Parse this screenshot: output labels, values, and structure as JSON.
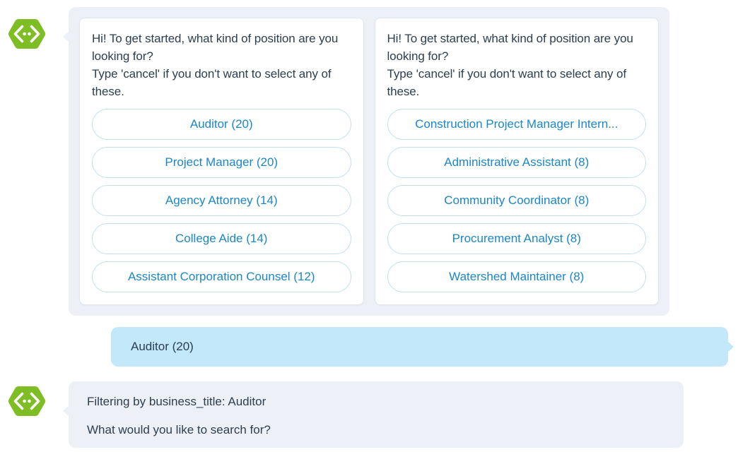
{
  "theme": {
    "avatar_green": "#7fbd25",
    "bot_bubble_bg": "#edf1f7",
    "user_bubble_bg": "#c3e8fa",
    "link_blue": "#1b87c9",
    "text_dark": "#2c3e50",
    "option_border": "#c4dfeb",
    "card_bg": "#ffffff",
    "card_border": "#e3e7ec",
    "page_bg": "#ffffff"
  },
  "messages": [
    {
      "sender": "bot",
      "avatar_icon": "code-brackets-hexagon-icon",
      "type": "option-cards",
      "cards": [
        {
          "prompt_line_1": "Hi! To get started, what kind of position are you looking for?",
          "prompt_line_2": "Type 'cancel' if you don't want to select any of these.",
          "options": [
            "Auditor (20)",
            "Project Manager (20)",
            "Agency Attorney (14)",
            "College Aide (14)",
            "Assistant Corporation Counsel (12)"
          ]
        },
        {
          "prompt_line_1": "Hi! To get started, what kind of position are you looking for?",
          "prompt_line_2": "Type 'cancel' if you don't want to select any of these.",
          "options": [
            "Construction Project Manager Intern...",
            "Administrative Assistant (8)",
            "Community Coordinator (8)",
            "Procurement Analyst (8)",
            "Watershed Maintainer (8)"
          ]
        }
      ]
    },
    {
      "sender": "user",
      "type": "text",
      "text": "Auditor (20)"
    },
    {
      "sender": "bot",
      "avatar_icon": "code-brackets-hexagon-icon",
      "type": "text",
      "line_1": "Filtering by business_title: Auditor",
      "line_2": "What would you like to search for?"
    }
  ]
}
